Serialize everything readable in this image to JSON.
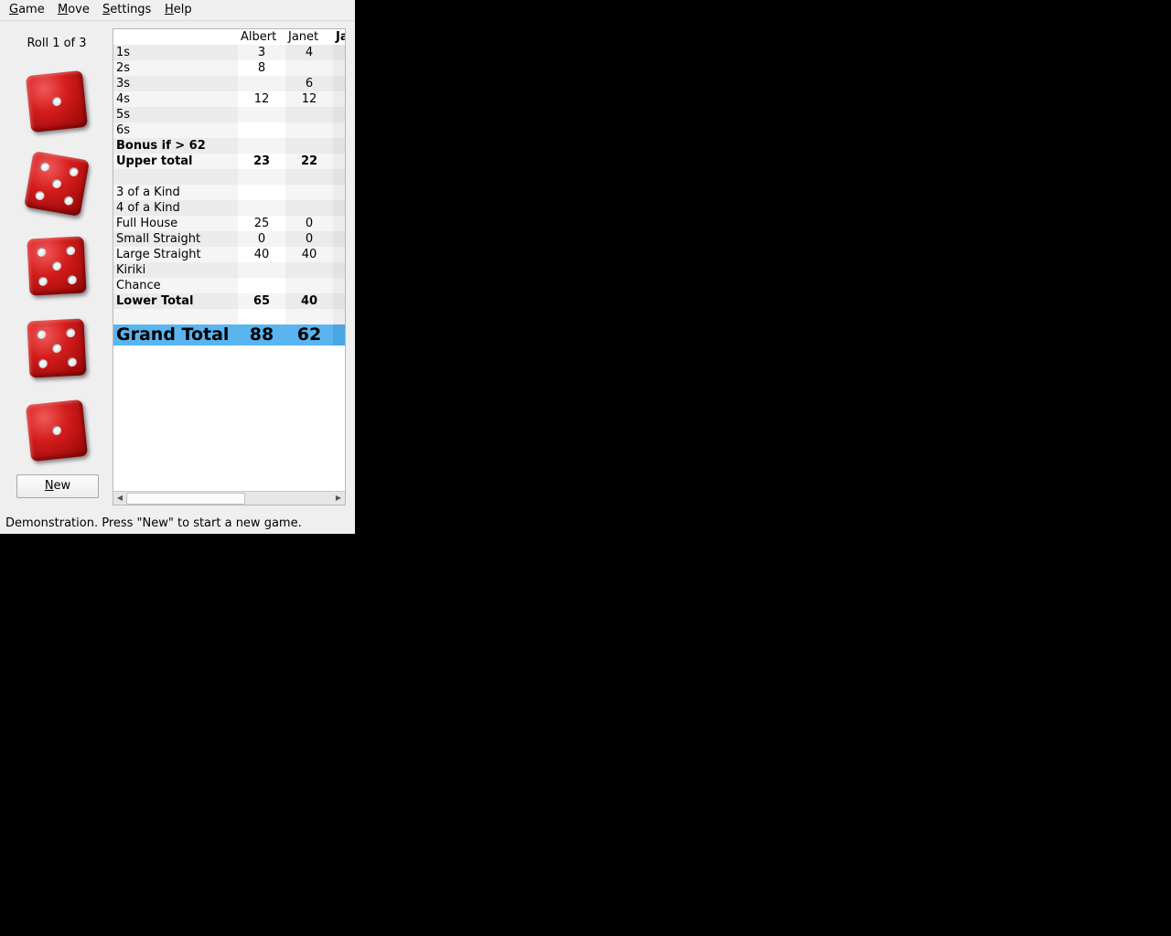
{
  "menu": [
    {
      "key": "G",
      "rest": "ame"
    },
    {
      "key": "M",
      "rest": "ove"
    },
    {
      "key": "S",
      "rest": "ettings"
    },
    {
      "key": "H",
      "rest": "elp"
    }
  ],
  "roll_label": "Roll 1 of 3",
  "dice": [
    1,
    5,
    5,
    5,
    1
  ],
  "new_button": {
    "key": "N",
    "rest": "ew"
  },
  "scoreboard": {
    "players": [
      "Albert",
      "Janet",
      "Ja"
    ],
    "rows": [
      {
        "label": "1s",
        "p1": "3",
        "p2": "4"
      },
      {
        "label": "2s",
        "p1": "8",
        "p2": ""
      },
      {
        "label": "3s",
        "p1": "",
        "p2": "6"
      },
      {
        "label": "4s",
        "p1": "12",
        "p2": "12"
      },
      {
        "label": "5s",
        "p1": "",
        "p2": ""
      },
      {
        "label": "6s",
        "p1": "",
        "p2": ""
      },
      {
        "label": "Bonus if > 62",
        "p1": "",
        "p2": ""
      },
      {
        "label": "Upper total",
        "p1": "23",
        "p2": "22"
      },
      {
        "label": "",
        "p1": "",
        "p2": ""
      },
      {
        "label": "3 of a Kind",
        "p1": "",
        "p2": ""
      },
      {
        "label": "4 of a Kind",
        "p1": "",
        "p2": ""
      },
      {
        "label": "Full House",
        "p1": "25",
        "p2": "0"
      },
      {
        "label": "Small Straight",
        "p1": "0",
        "p2": "0"
      },
      {
        "label": "Large Straight",
        "p1": "40",
        "p2": "40"
      },
      {
        "label": "Kiriki",
        "p1": "",
        "p2": ""
      },
      {
        "label": "Chance",
        "p1": "",
        "p2": ""
      },
      {
        "label": "Lower Total",
        "p1": "65",
        "p2": "40"
      },
      {
        "label": "",
        "p1": "",
        "p2": ""
      }
    ],
    "grand_total": {
      "label": "Grand Total",
      "p1": "88",
      "p2": "62"
    }
  },
  "status_text": "Demonstration. Press \"New\" to start a new game.",
  "colors": {
    "die": "#d41c1c",
    "grand_total_bg": "#5ab4f0"
  }
}
